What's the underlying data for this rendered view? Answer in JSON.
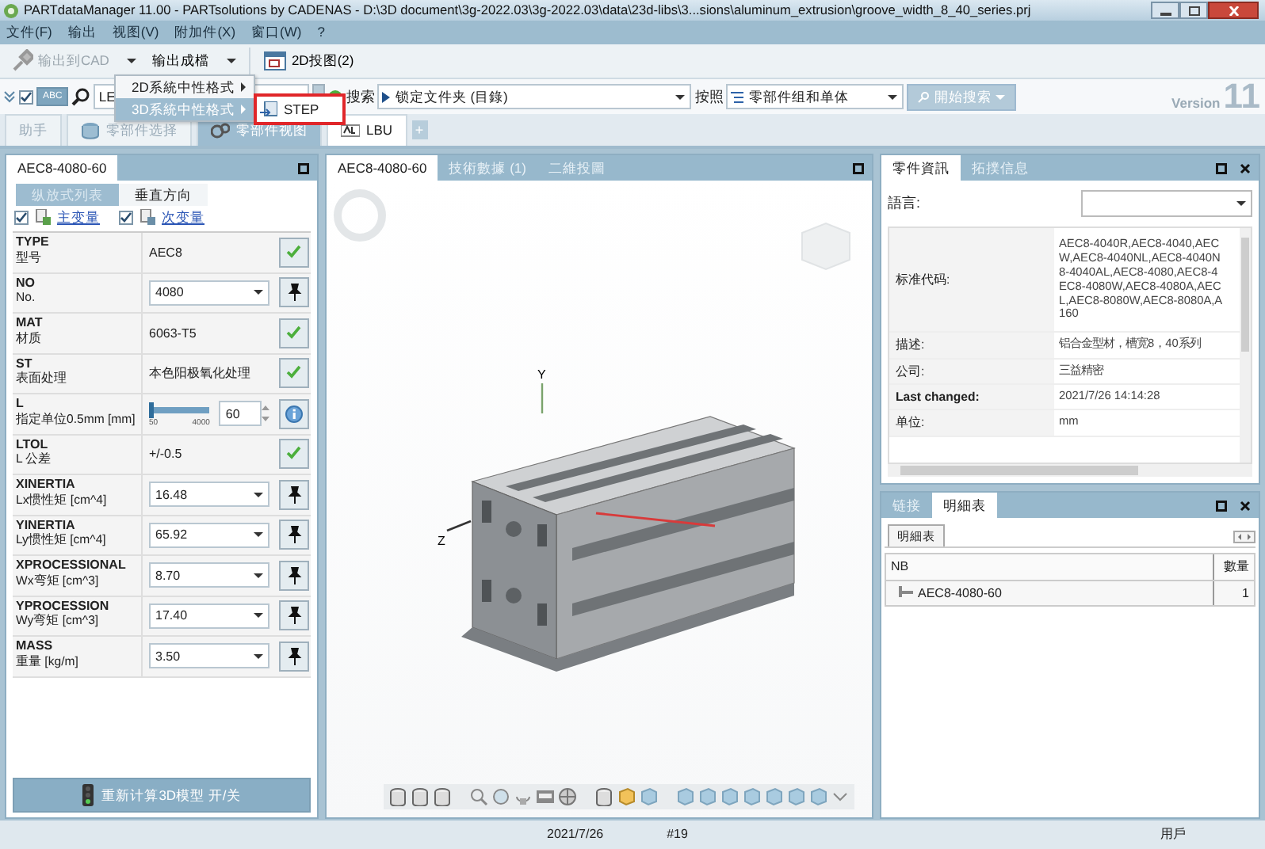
{
  "window": {
    "title": "PARTdataManager 11.00 - PARTsolutions by CADENAS - D:\\3D document\\3g-2022.03\\3g-2022.03\\data\\23d-libs\\3...sions\\aluminum_extrusion\\groove_width_8_40_series.prj"
  },
  "menu": [
    "文件(F)",
    "输出",
    "视图(V)",
    "附加件(X)",
    "窗口(W)",
    "?"
  ],
  "toolbar": [
    {
      "label": "输出到CAD",
      "disabled": true,
      "dropdown": true
    },
    {
      "label": "输出成檔",
      "disabled": false,
      "dropdown": true
    },
    {
      "label": "2D投图(2)",
      "disabled": false,
      "dropdown": false
    }
  ],
  "dropdown_menu": {
    "items": [
      {
        "label": "2D系統中性格式",
        "selected": false
      },
      {
        "label": "3D系統中性格式",
        "selected": true
      }
    ],
    "submenu": [
      {
        "label": "STEP",
        "highlighted": true
      }
    ]
  },
  "search_bar": {
    "checked": true,
    "abc_toggle": {
      "label": "ABC",
      "on": true
    },
    "query": "LE",
    "search_label": "搜索",
    "folder": "锁定文件夹 (目錄)",
    "by_label": "按照",
    "scope": "零部件组和单体",
    "search_button": {
      "label": "開始搜索",
      "disabled": true
    },
    "version_label": "Version",
    "version_number": "11"
  },
  "main_tabs": [
    {
      "label": "助手",
      "selected": false
    },
    {
      "label": "零部件选择",
      "selected": false
    },
    {
      "label": "零部件视图",
      "selected": true
    },
    {
      "label": "LBU",
      "selected": false
    }
  ],
  "add_tab": "+",
  "left_panel": {
    "title": "AEC8-4080-60",
    "subtabs": [
      {
        "label": "纵放式列表",
        "selected": false
      },
      {
        "label": "垂直方向",
        "selected": true
      }
    ],
    "filters": [
      {
        "label": "主变量",
        "checked": true
      },
      {
        "label": "次变量",
        "checked": true
      }
    ],
    "rows": [
      {
        "name": "TYPE",
        "label": "型号",
        "kind": "text",
        "value": "AEC8",
        "button": {
          "kind": "check"
        }
      },
      {
        "name": "NO",
        "label": "No.",
        "kind": "combo",
        "value": "4080",
        "button": {
          "kind": "pin"
        }
      },
      {
        "name": "MAT",
        "label": "材质",
        "kind": "text",
        "value": "6063-T5",
        "button": {
          "kind": "check"
        }
      },
      {
        "name": "ST",
        "label": "表面处理",
        "kind": "text",
        "value": "本色阳极氧化处理",
        "button": {
          "kind": "check"
        }
      },
      {
        "name": "L",
        "label": "指定单位0.5mm [mm]",
        "kind": "slider",
        "level": 0.003,
        "min_label": "50",
        "max_label": "4000",
        "value": "60",
        "button": {
          "kind": "info"
        }
      },
      {
        "name": "LTOL",
        "label": "L 公差",
        "kind": "text",
        "value": "+/-0.5",
        "button": {
          "kind": "check"
        }
      },
      {
        "name": "XINERTIA",
        "label": "Lx惯性矩 [cm^4]",
        "kind": "combo",
        "value": "16.48",
        "button": {
          "kind": "pin"
        }
      },
      {
        "name": "YINERTIA",
        "label": "Ly惯性矩 [cm^4]",
        "kind": "combo",
        "value": "65.92",
        "button": {
          "kind": "pin"
        }
      },
      {
        "name": "XPROCESSIONAL",
        "label": "Wx弯矩 [cm^3]",
        "kind": "combo",
        "value": "8.70",
        "button": {
          "kind": "pin"
        }
      },
      {
        "name": "YPROCESSION",
        "label": "Wy弯矩 [cm^3]",
        "kind": "combo",
        "value": "17.40",
        "button": {
          "kind": "pin"
        }
      },
      {
        "name": "MASS",
        "label": "重量 [kg/m]",
        "kind": "combo",
        "value": "3.50",
        "button": {
          "kind": "pin"
        }
      }
    ],
    "recalc_button": "重新计算3D模型 开/关"
  },
  "viewer": {
    "tabs": [
      {
        "label": "AEC8-4080-60",
        "selected": true
      },
      {
        "label": "技術數據 (1)",
        "selected": false
      },
      {
        "label": "二維投圖",
        "selected": false
      }
    ],
    "axis_labels": [
      "Y",
      "Z"
    ]
  },
  "info_panel": {
    "tabs": [
      {
        "label": "零件資訊",
        "selected": true
      },
      {
        "label": "拓撲信息",
        "selected": false
      }
    ],
    "language_label": "語言:",
    "properties": [
      {
        "key": "标准代码:",
        "bold": false,
        "lines": [
          "AEC8-4040R,AEC8-4040,AEC",
          "W,AEC8-4040NL,AEC8-4040N",
          "8-4040AL,AEC8-4080,AEC8-4",
          "EC8-4080W,AEC8-4080A,AEC",
          "L,AEC8-8080W,AEC8-8080A,A",
          "160"
        ]
      },
      {
        "key": "描述:",
        "bold": false,
        "lines": [
          "铝合金型材，槽宽8，40系列"
        ]
      },
      {
        "key": "公司:",
        "bold": false,
        "lines": [
          "三益精密"
        ]
      },
      {
        "key": "Last changed:",
        "bold": true,
        "lines": [
          "2021/7/26 14:14:28"
        ]
      },
      {
        "key": "单位:",
        "bold": false,
        "lines": [
          "mm"
        ]
      }
    ]
  },
  "bom_panel": {
    "tabs": [
      {
        "label": "链接",
        "selected": false
      },
      {
        "label": "明細表",
        "selected": true
      }
    ],
    "subtab": "明細表",
    "columns": [
      "NB",
      "數量"
    ],
    "rows": [
      {
        "name": "AEC8-4080-60",
        "quantity": "1"
      }
    ]
  },
  "status_bar": [
    "2021/7/26",
    "#19",
    "用戶"
  ]
}
